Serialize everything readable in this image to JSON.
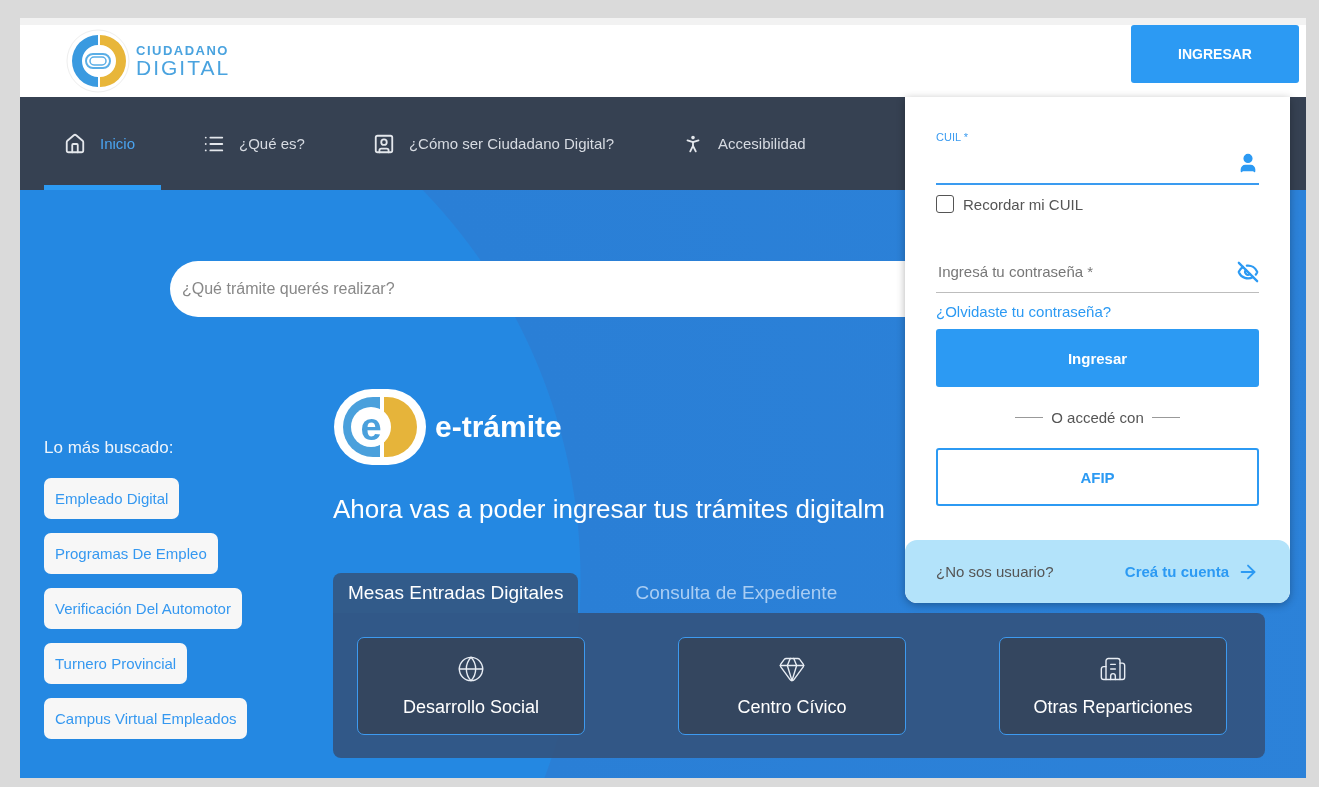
{
  "header": {
    "logo": {
      "line1": "CIUDADANO",
      "line2": "DIGITAL"
    },
    "login_button": "INGRESAR"
  },
  "nav": [
    {
      "label": "Inicio",
      "selected": true
    },
    {
      "label": "¿Qué es?",
      "selected": false
    },
    {
      "label": "¿Cómo ser Ciudadano Digital?",
      "selected": false
    },
    {
      "label": "Accesibilidad",
      "selected": false
    }
  ],
  "search": {
    "placeholder": "¿Qué trámite querés realizar?"
  },
  "most_searched": {
    "title": "Lo más buscado:",
    "items": [
      "Empleado Digital",
      "Programas De Empleo",
      "Verificación Del Automotor",
      "Turnero Provincial",
      "Campus Virtual Empleados"
    ]
  },
  "brand": {
    "logo_letter": "e",
    "name": "e-trámite"
  },
  "tagline": "Ahora vas a poder ingresar tus trámites digitalm",
  "tabs": [
    {
      "label": "Mesas Entradas Digitales",
      "selected": true
    },
    {
      "label": "Consulta de Expediente",
      "selected": false
    }
  ],
  "cards": [
    {
      "label": "Desarrollo Social"
    },
    {
      "label": "Centro Cívico"
    },
    {
      "label": "Otras Reparticiones"
    }
  ],
  "login": {
    "cuil": {
      "label": "CUIL *",
      "focused": true
    },
    "remember": {
      "label": "Recordar mi CUIL",
      "checked": false
    },
    "password": {
      "placeholder": "Ingresá tu contraseña *"
    },
    "forgot": "¿Olvidaste tu contraseña?",
    "submit": "Ingresar",
    "divider": "O accedé con",
    "afip": "AFIP",
    "signup_prompt": "¿No sos usuario?",
    "signup_link": "Creá tu cuenta"
  }
}
